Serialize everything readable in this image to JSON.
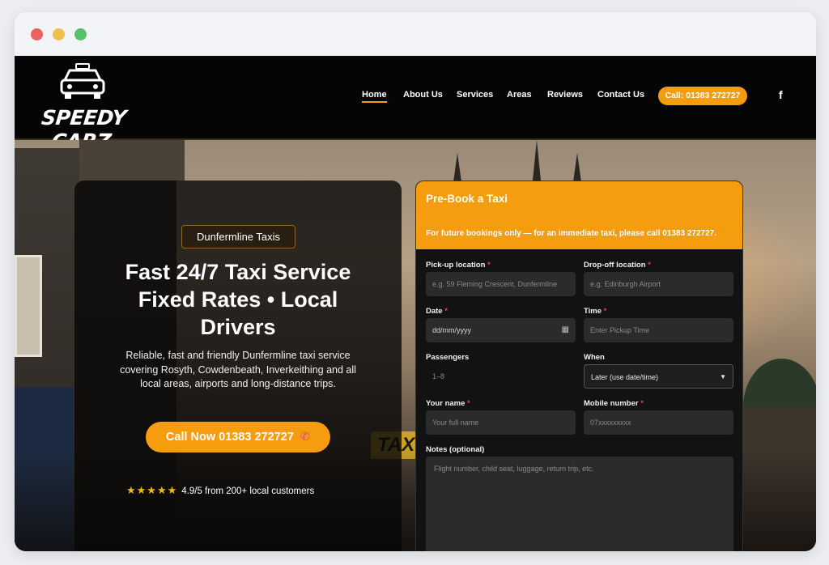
{
  "brand": {
    "name": "SPEEDY CARZ"
  },
  "nav": {
    "items": [
      {
        "label": "Home",
        "active": true
      },
      {
        "label": "About Us"
      },
      {
        "label": "Services"
      },
      {
        "label": "Areas"
      },
      {
        "label": "Reviews"
      },
      {
        "label": "Contact Us"
      }
    ],
    "call_label": "Call: 01383 272727",
    "facebook_icon": "facebook-icon"
  },
  "hero": {
    "badge": "Dunfermline Taxis",
    "title_line1": "Fast 24/7 Taxi Service",
    "title_line2": "Fixed Rates • Local",
    "title_line3": "Drivers",
    "description": "Reliable, fast and friendly Dunfermline taxi service covering Rosyth, Cowdenbeath, Inverkeithing and all local areas, airports and long-distance trips.",
    "cta_label": "Call Now 01383 272727",
    "cta_icon": "phone-icon",
    "rating_stars": 5,
    "rating_text": "4.9/5 from 200+ local customers"
  },
  "form": {
    "title": "Pre-Book a Taxi",
    "note": "For future bookings only — for an immediate taxi, please call 01383 272727.",
    "pickup": {
      "label": "Pick-up location",
      "placeholder": "e.g. 59 Fleming Crescent, Dunfermline"
    },
    "dropoff": {
      "label": "Drop-off location",
      "placeholder": "e.g. Edinburgh Airport"
    },
    "date": {
      "label": "Date",
      "value": "dd/mm/yyyy"
    },
    "time": {
      "label": "Time",
      "placeholder": "Enter Pickup Time"
    },
    "passengers": {
      "label": "Passengers",
      "placeholder": "1–8"
    },
    "when": {
      "label": "When",
      "selected": "Later (use date/time)"
    },
    "name": {
      "label": "Your name",
      "placeholder": "Your full name"
    },
    "mobile": {
      "label": "Mobile number",
      "placeholder": "07xxxxxxxxx"
    },
    "notes": {
      "label": "Notes (optional)",
      "placeholder": "Flight number, child seat, luggage, return trip, etc."
    }
  },
  "colors": {
    "accent": "#f59d0e",
    "required": "#e34040"
  }
}
